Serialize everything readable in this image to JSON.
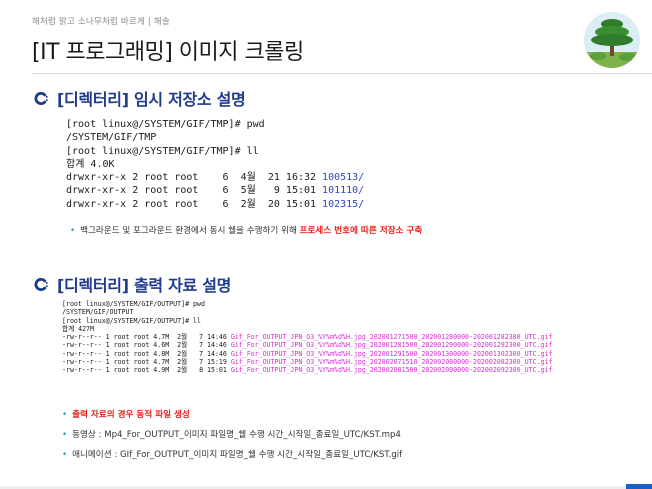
{
  "header": {
    "tagline": "해처럼 밝고 소나무처럼 바르게 | 해솔",
    "title": "[IT 프로그래밍] 이미지 크롤링"
  },
  "sections": [
    {
      "title": "[디렉터리] 임시 저장소 설명",
      "commands": [
        "[root linux@/SYSTEM/GIF/TMP]# pwd",
        "/SYSTEM/GIF/TMP",
        "[root linux@/SYSTEM/GIF/TMP]# ll",
        "합계 4.0K"
      ],
      "listing": [
        {
          "meta": "drwxr-xr-x 2 root root    6  4월  21 16:32 ",
          "name": "100513/"
        },
        {
          "meta": "drwxr-xr-x 2 root root    6  5월   9 15:01 ",
          "name": "101110/"
        },
        {
          "meta": "drwxr-xr-x 2 root root    6  2월  20 15:01 ",
          "name": "102315/"
        }
      ],
      "note_prefix": "백그라운드 및 포그라운드 환경에서 동시 쉘을 수행하기 위해 ",
      "note_highlight": "프로세스 번호에 따른 저장소 구축"
    },
    {
      "title": "[디렉터리] 출력 자료 설명",
      "commands": [
        "[root linux@/SYSTEM/GIF/OUTPUT]# pwd",
        "/SYSTEM/GIF/OUTPUT",
        "[root linux@/SYSTEM/GIF/OUTPUT]# ll",
        "합계 427M"
      ],
      "listing": [
        {
          "meta": "-rw-r--r-- 1 root root 4.7M  2월   7 14:46 ",
          "name": "Gif_For_OUTPUT_JPN_O3_%Y%m%d%H.jpg_202001271500_202001280000-202001282300_UTC.gif"
        },
        {
          "meta": "-rw-r--r-- 1 root root 4.6M  2월   7 14:46 ",
          "name": "Gif_For_OUTPUT_JPN_O3_%Y%m%d%H.jpg_202001281500_202001290000-202001292300_UTC.gif"
        },
        {
          "meta": "-rw-r--r-- 1 root root 4.8M  2월   7 14:46 ",
          "name": "Gif_For_OUTPUT_JPN_O3_%Y%m%d%H.jpg_202001291500_202001300000-202001302300_UTC.gif"
        },
        {
          "meta": "-rw-r--r-- 1 root root 4.7M  2월   7 15:19 ",
          "name": "Gif_For_OUTPUT_JPN_O3_%Y%m%d%H.jpg_202002071518_202002080000-202002082300_UTC.gif"
        },
        {
          "meta": "-rw-r--r-- 1 root root 4.9M  2월   8 15:01 ",
          "name": "Gif_For_OUTPUT_JPN_O3_%Y%m%d%H.jpg_202002081500_202002090000-202002092300_UTC.gif"
        }
      ],
      "bullets": [
        "출력 자료의 경우 동적 파일 생성",
        "동영상 : Mp4_For_OUTPUT_이미지 파일명_쉘 수행 시간_시작일_종료일_UTC/KST.mp4",
        "애니메이션 : GIf_For_OUTPUT_이미지 파일명_쉘 수행 시간_시작일_종료일_UTC/KST.gif"
      ]
    }
  ],
  "icons": {
    "section_bullet": "c-bullet-icon",
    "logo": "pine-tree-logo-icon"
  },
  "colors": {
    "section_title": "#1f3b8c",
    "dir_name": "#2b44c6",
    "file_name": "#dd2bd8",
    "highlight": "#e8211b",
    "bullet_dot": "#16a0b0"
  }
}
